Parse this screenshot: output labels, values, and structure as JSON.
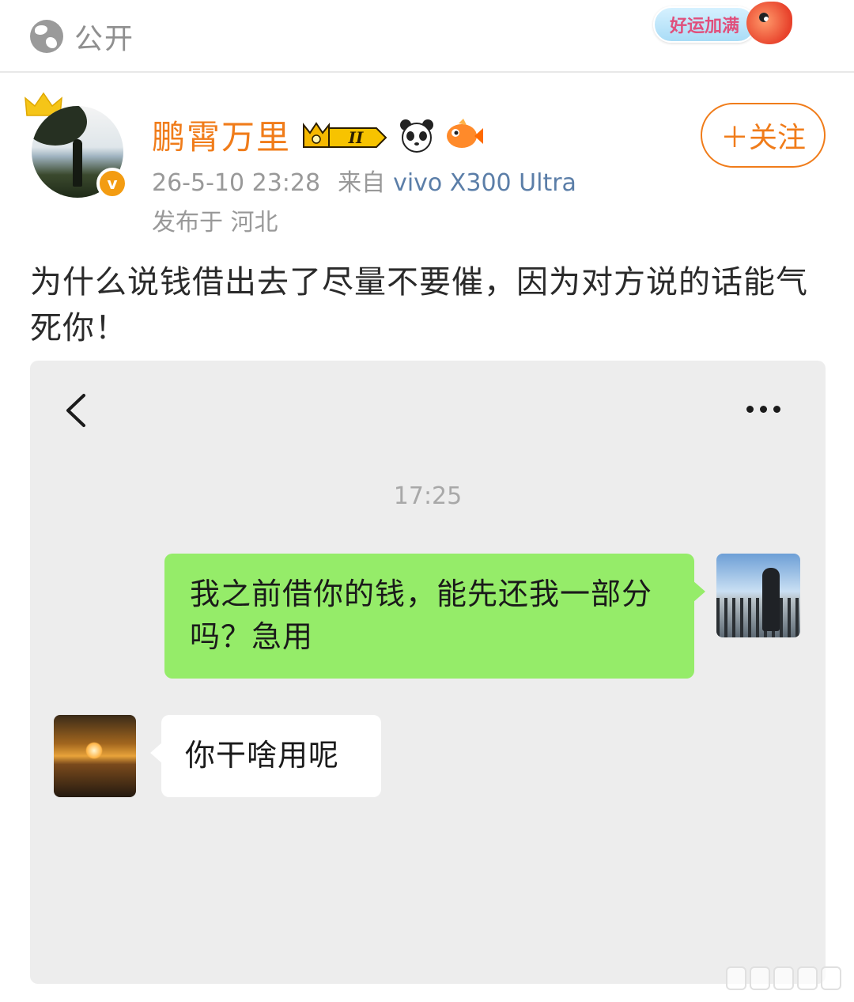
{
  "topbar": {
    "visibility_label": "公开",
    "luck_badge_text": "好运加满"
  },
  "post": {
    "username": "鹏霄万里",
    "level_text": "II",
    "timestamp": "26-5-10 23:28",
    "source_prefix": "来自",
    "device": "vivo X300 Ultra",
    "location": "发布于 河北",
    "follow_label": "＋关注",
    "text": "为什么说钱借出去了尽量不要催，因为对方说的话能气死你！",
    "colors": {
      "username": "#f07c1a",
      "device": "#5b7ea8",
      "follow": "#f07c1a"
    }
  },
  "chat": {
    "time": "17:25",
    "messages": [
      {
        "side": "right",
        "text": "我之前借你的钱，能先还我一部分吗？急用"
      },
      {
        "side": "left",
        "text": "你干啥用呢"
      }
    ],
    "colors": {
      "background": "#ededed",
      "sent_bubble": "#95ec69",
      "received_bubble": "#ffffff"
    }
  }
}
